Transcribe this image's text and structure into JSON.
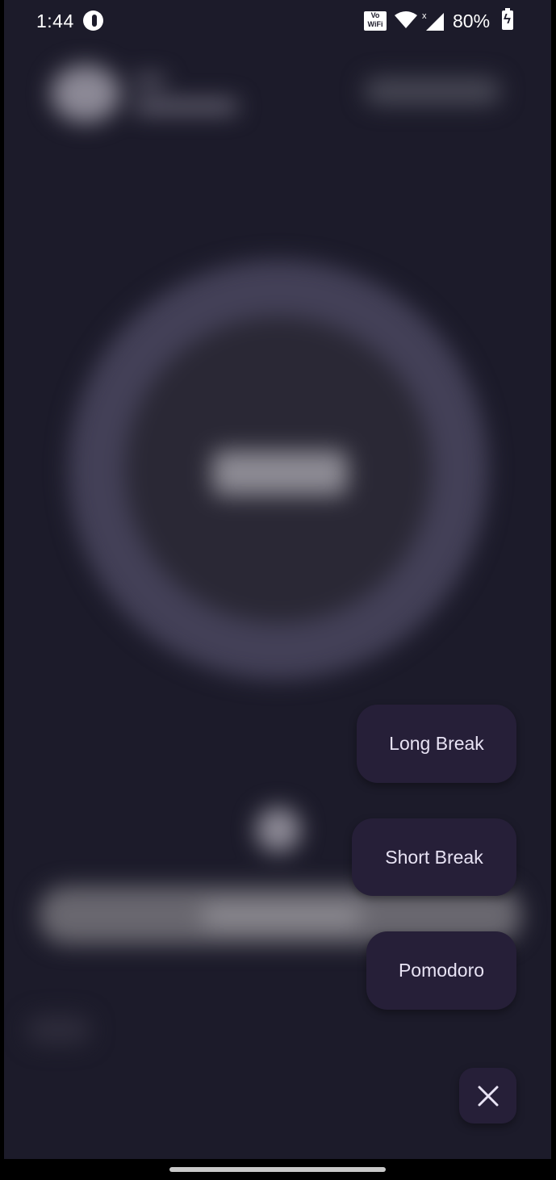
{
  "status_bar": {
    "time": "1:44",
    "vowifi_label": "Vo WiFi",
    "battery_percent": "80%",
    "icons": [
      "app-notification-icon",
      "vowifi-icon",
      "wifi-icon",
      "signal-icon",
      "battery-charging-icon"
    ]
  },
  "speed_dial": {
    "options": [
      {
        "label": "Long Break"
      },
      {
        "label": "Short Break"
      },
      {
        "label": "Pomodoro"
      }
    ],
    "close_icon": "close-icon"
  },
  "colors": {
    "background": "#1c1b2a",
    "menu_button": "#261f38",
    "menu_text": "#e8e3f4"
  }
}
